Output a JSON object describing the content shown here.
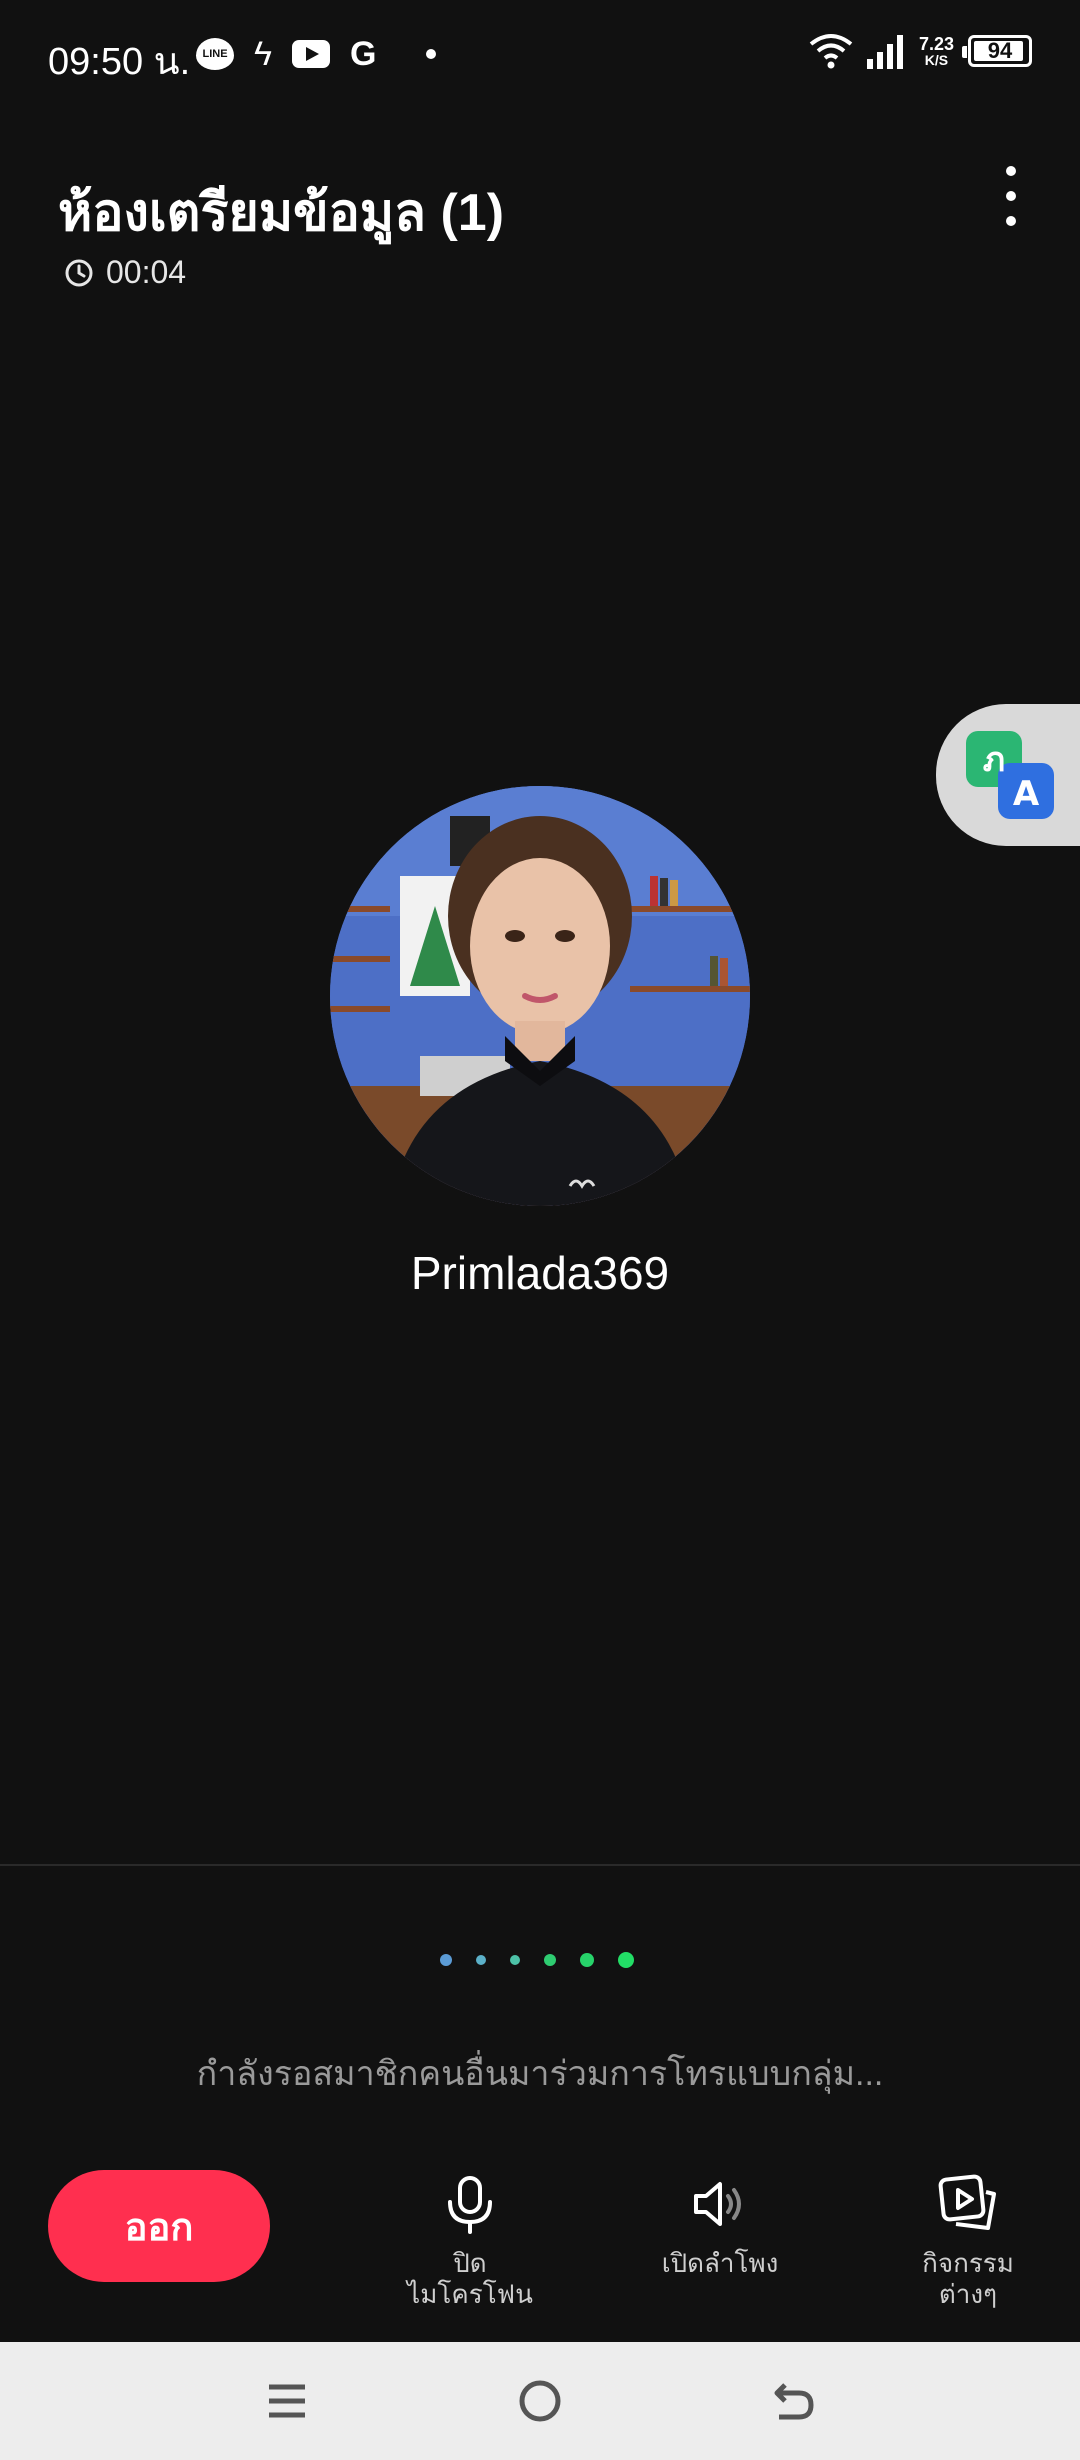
{
  "status_bar": {
    "time": "09:50 น.",
    "speed_value": "7.23",
    "speed_unit": "K/S",
    "battery": "94",
    "battery_level": 0.94,
    "line_label": "LINE",
    "google_label": "G"
  },
  "header": {
    "title": "ห้องเตรียมข้อมูล (1)",
    "timer": "00:04"
  },
  "participant": {
    "name": "Primlada369"
  },
  "waiting": {
    "text": "กำลังรอสมาชิกคนอื่นมาร่วมการโทรแบบกลุ่ม...",
    "dot_colors": [
      "#5b9bd5",
      "#5bb0c8",
      "#4dc2a8",
      "#2ecc71",
      "#27d36a",
      "#22dd66"
    ]
  },
  "controls": {
    "exit_label": "ออก",
    "mic_label_line1": "ปิด",
    "mic_label_line2": "ไมโครโฟน",
    "speaker_label": "เปิดลำโพง",
    "activities_line1": "กิจกรรม",
    "activities_line2": "ต่างๆ"
  },
  "translate": {
    "letter_th": "ภ",
    "letter_en": "A"
  },
  "colors": {
    "background": "#111111",
    "exit": "#ff2f4f",
    "navbar": "#ededed"
  }
}
